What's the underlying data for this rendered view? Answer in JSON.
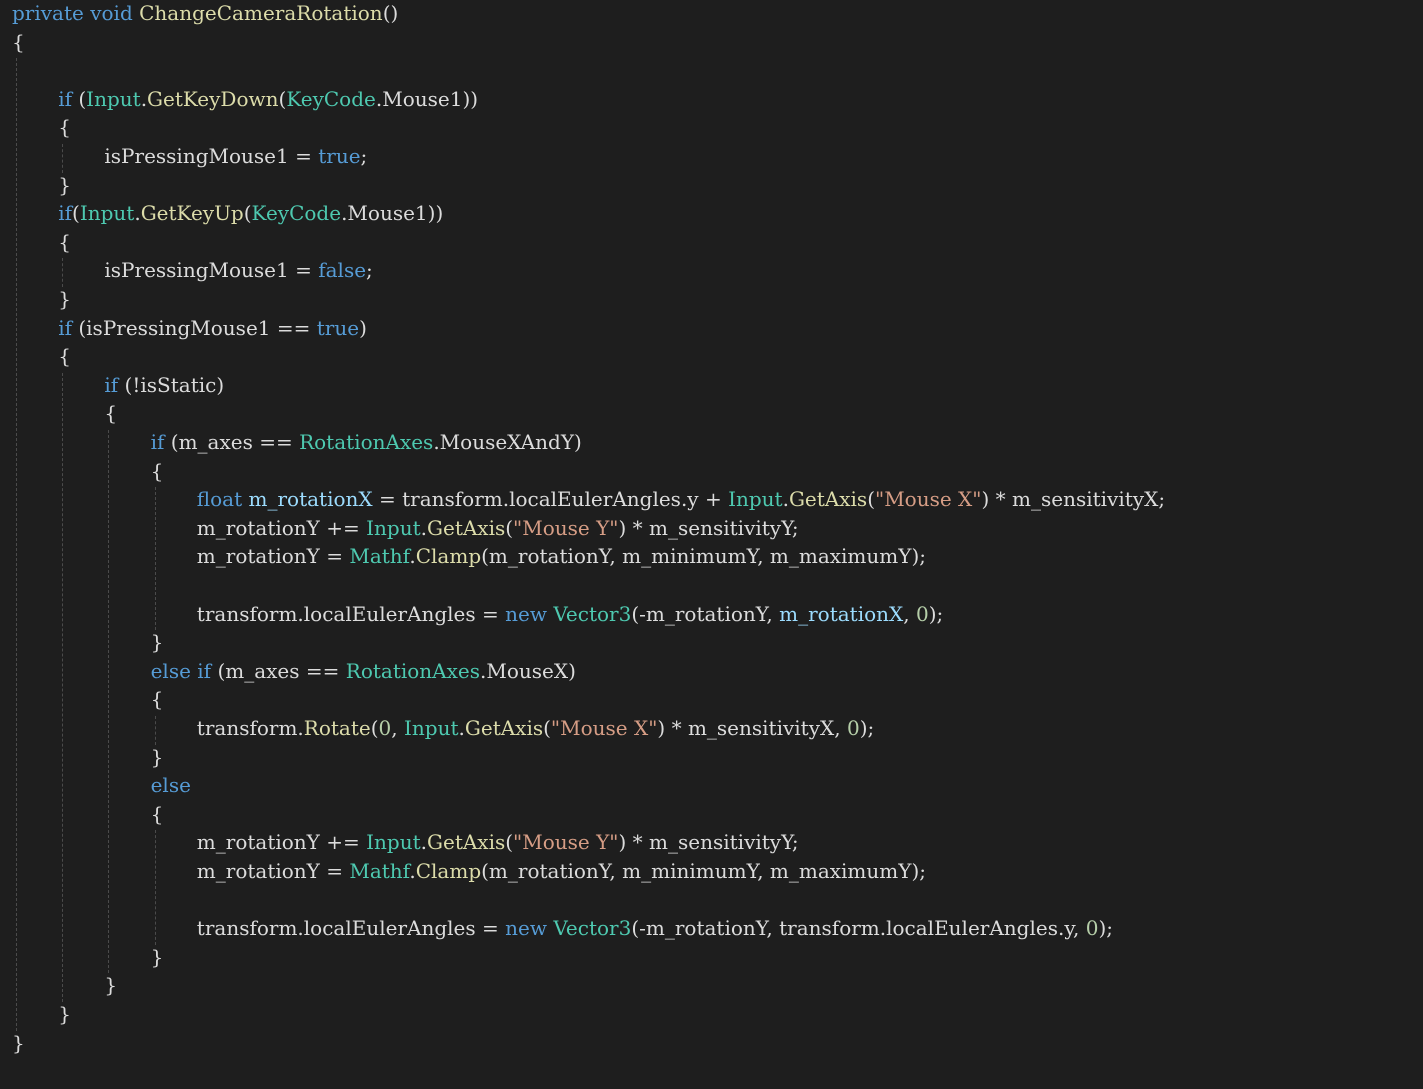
{
  "theme": {
    "background": "#1e1e1e",
    "plain": "#dcdcdc",
    "keyword": "#569cd6",
    "type": "#4ec9b0",
    "method": "#dcdcaa",
    "string": "#d69d85",
    "number": "#b5cea8",
    "local": "#9cdcfe",
    "guide": "#4b4b4b"
  },
  "lines": [
    {
      "indent": 0,
      "tokens": [
        [
          "kw",
          "private"
        ],
        [
          "pl",
          " "
        ],
        [
          "kw",
          "void"
        ],
        [
          "pl",
          " "
        ],
        [
          "fn",
          "ChangeCameraRotation"
        ],
        [
          "pl",
          "()"
        ]
      ]
    },
    {
      "indent": 0,
      "tokens": [
        [
          "pl",
          "{"
        ]
      ]
    },
    {
      "indent": 0,
      "tokens": []
    },
    {
      "indent": 1,
      "tokens": [
        [
          "kw",
          "if"
        ],
        [
          "pl",
          " ("
        ],
        [
          "ty",
          "Input"
        ],
        [
          "pl",
          "."
        ],
        [
          "fn",
          "GetKeyDown"
        ],
        [
          "pl",
          "("
        ],
        [
          "ty",
          "KeyCode"
        ],
        [
          "pl",
          ".Mouse1))"
        ]
      ]
    },
    {
      "indent": 1,
      "tokens": [
        [
          "pl",
          "{"
        ]
      ]
    },
    {
      "indent": 2,
      "tokens": [
        [
          "pl",
          "isPressingMouse1 = "
        ],
        [
          "kw",
          "true"
        ],
        [
          "pl",
          ";"
        ]
      ]
    },
    {
      "indent": 1,
      "tokens": [
        [
          "pl",
          "}"
        ]
      ]
    },
    {
      "indent": 1,
      "tokens": [
        [
          "kw",
          "if"
        ],
        [
          "pl",
          "("
        ],
        [
          "ty",
          "Input"
        ],
        [
          "pl",
          "."
        ],
        [
          "fn",
          "GetKeyUp"
        ],
        [
          "pl",
          "("
        ],
        [
          "ty",
          "KeyCode"
        ],
        [
          "pl",
          ".Mouse1))"
        ]
      ]
    },
    {
      "indent": 1,
      "tokens": [
        [
          "pl",
          "{"
        ]
      ]
    },
    {
      "indent": 2,
      "tokens": [
        [
          "pl",
          "isPressingMouse1 = "
        ],
        [
          "kw",
          "false"
        ],
        [
          "pl",
          ";"
        ]
      ]
    },
    {
      "indent": 1,
      "tokens": [
        [
          "pl",
          "}"
        ]
      ]
    },
    {
      "indent": 1,
      "tokens": [
        [
          "kw",
          "if"
        ],
        [
          "pl",
          " (isPressingMouse1 == "
        ],
        [
          "kw",
          "true"
        ],
        [
          "pl",
          ")"
        ]
      ]
    },
    {
      "indent": 1,
      "tokens": [
        [
          "pl",
          "{"
        ]
      ]
    },
    {
      "indent": 2,
      "tokens": [
        [
          "kw",
          "if"
        ],
        [
          "pl",
          " (!isStatic)"
        ]
      ]
    },
    {
      "indent": 2,
      "tokens": [
        [
          "pl",
          "{"
        ]
      ]
    },
    {
      "indent": 3,
      "tokens": [
        [
          "kw",
          "if"
        ],
        [
          "pl",
          " (m_axes == "
        ],
        [
          "ty",
          "RotationAxes"
        ],
        [
          "pl",
          ".MouseXAndY)"
        ]
      ]
    },
    {
      "indent": 3,
      "tokens": [
        [
          "pl",
          "{"
        ]
      ]
    },
    {
      "indent": 4,
      "tokens": [
        [
          "kw",
          "float"
        ],
        [
          "pl",
          " "
        ],
        [
          "var",
          "m_rotationX"
        ],
        [
          "pl",
          " = transform.localEulerAngles.y + "
        ],
        [
          "ty",
          "Input"
        ],
        [
          "pl",
          "."
        ],
        [
          "fn",
          "GetAxis"
        ],
        [
          "pl",
          "("
        ],
        [
          "str",
          "\"Mouse X\""
        ],
        [
          "pl",
          ") * m_sensitivityX;"
        ]
      ]
    },
    {
      "indent": 4,
      "tokens": [
        [
          "pl",
          "m_rotationY += "
        ],
        [
          "ty",
          "Input"
        ],
        [
          "pl",
          "."
        ],
        [
          "fn",
          "GetAxis"
        ],
        [
          "pl",
          "("
        ],
        [
          "str",
          "\"Mouse Y\""
        ],
        [
          "pl",
          ") * m_sensitivityY;"
        ]
      ]
    },
    {
      "indent": 4,
      "tokens": [
        [
          "pl",
          "m_rotationY = "
        ],
        [
          "ty",
          "Mathf"
        ],
        [
          "pl",
          "."
        ],
        [
          "fn",
          "Clamp"
        ],
        [
          "pl",
          "(m_rotationY, m_minimumY, m_maximumY);"
        ]
      ]
    },
    {
      "indent": 4,
      "tokens": []
    },
    {
      "indent": 4,
      "tokens": [
        [
          "pl",
          "transform.localEulerAngles = "
        ],
        [
          "kw",
          "new"
        ],
        [
          "pl",
          " "
        ],
        [
          "ty",
          "Vector3"
        ],
        [
          "pl",
          "(-m_rotationY, "
        ],
        [
          "var",
          "m_rotationX"
        ],
        [
          "pl",
          ", "
        ],
        [
          "num",
          "0"
        ],
        [
          "pl",
          ");"
        ]
      ]
    },
    {
      "indent": 3,
      "tokens": [
        [
          "pl",
          "}"
        ]
      ]
    },
    {
      "indent": 3,
      "tokens": [
        [
          "kw",
          "else if"
        ],
        [
          "pl",
          " (m_axes == "
        ],
        [
          "ty",
          "RotationAxes"
        ],
        [
          "pl",
          ".MouseX)"
        ]
      ]
    },
    {
      "indent": 3,
      "tokens": [
        [
          "pl",
          "{"
        ]
      ]
    },
    {
      "indent": 4,
      "tokens": [
        [
          "pl",
          "transform."
        ],
        [
          "fn",
          "Rotate"
        ],
        [
          "pl",
          "("
        ],
        [
          "num",
          "0"
        ],
        [
          "pl",
          ", "
        ],
        [
          "ty",
          "Input"
        ],
        [
          "pl",
          "."
        ],
        [
          "fn",
          "GetAxis"
        ],
        [
          "pl",
          "("
        ],
        [
          "str",
          "\"Mouse X\""
        ],
        [
          "pl",
          ") * m_sensitivityX, "
        ],
        [
          "num",
          "0"
        ],
        [
          "pl",
          ");"
        ]
      ]
    },
    {
      "indent": 3,
      "tokens": [
        [
          "pl",
          "}"
        ]
      ]
    },
    {
      "indent": 3,
      "tokens": [
        [
          "kw",
          "else"
        ]
      ]
    },
    {
      "indent": 3,
      "tokens": [
        [
          "pl",
          "{"
        ]
      ]
    },
    {
      "indent": 4,
      "tokens": [
        [
          "pl",
          "m_rotationY += "
        ],
        [
          "ty",
          "Input"
        ],
        [
          "pl",
          "."
        ],
        [
          "fn",
          "GetAxis"
        ],
        [
          "pl",
          "("
        ],
        [
          "str",
          "\"Mouse Y\""
        ],
        [
          "pl",
          ") * m_sensitivityY;"
        ]
      ]
    },
    {
      "indent": 4,
      "tokens": [
        [
          "pl",
          "m_rotationY = "
        ],
        [
          "ty",
          "Mathf"
        ],
        [
          "pl",
          "."
        ],
        [
          "fn",
          "Clamp"
        ],
        [
          "pl",
          "(m_rotationY, m_minimumY, m_maximumY);"
        ]
      ]
    },
    {
      "indent": 4,
      "tokens": []
    },
    {
      "indent": 4,
      "tokens": [
        [
          "pl",
          "transform.localEulerAngles = "
        ],
        [
          "kw",
          "new"
        ],
        [
          "pl",
          " "
        ],
        [
          "ty",
          "Vector3"
        ],
        [
          "pl",
          "(-m_rotationY, transform.localEulerAngles.y, "
        ],
        [
          "num",
          "0"
        ],
        [
          "pl",
          ");"
        ]
      ]
    },
    {
      "indent": 3,
      "tokens": [
        [
          "pl",
          "}"
        ]
      ]
    },
    {
      "indent": 2,
      "tokens": [
        [
          "pl",
          "}"
        ]
      ]
    },
    {
      "indent": 1,
      "tokens": [
        [
          "pl",
          "}"
        ]
      ]
    },
    {
      "indent": 0,
      "tokens": [
        [
          "pl",
          "}"
        ]
      ]
    }
  ]
}
